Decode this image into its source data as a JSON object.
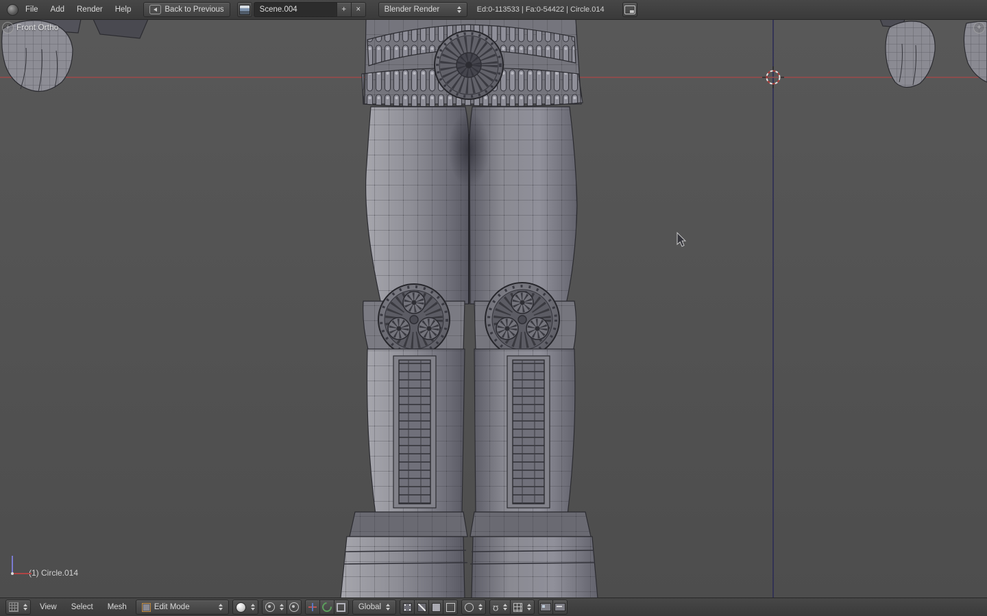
{
  "top_header": {
    "menus": [
      "File",
      "Add",
      "Render",
      "Help"
    ],
    "back_button": "Back to Previous",
    "scene_name": "Scene.004",
    "add_scene": "+",
    "unlink_scene": "×",
    "render_engine": "Blender Render",
    "stats": "Ed:0-113533 | Fa:0-54422 | Circle.014"
  },
  "viewport": {
    "view_label": "Front Ortho",
    "object_name": "(1) Circle.014",
    "corner_plus": "+"
  },
  "bottom_header": {
    "menus": [
      "View",
      "Select",
      "Mesh"
    ],
    "mode": "Edit Mode",
    "orientation": "Global"
  },
  "colors": {
    "header_bg": "#3f3f3f",
    "viewport_bg": "#545454",
    "axis_x": "#9e4a4a",
    "axis_z": "#2c2c55",
    "mesh_fill": "#8f8f97",
    "wireframe": "#3f3f46",
    "cursor_red": "#b2403c"
  }
}
